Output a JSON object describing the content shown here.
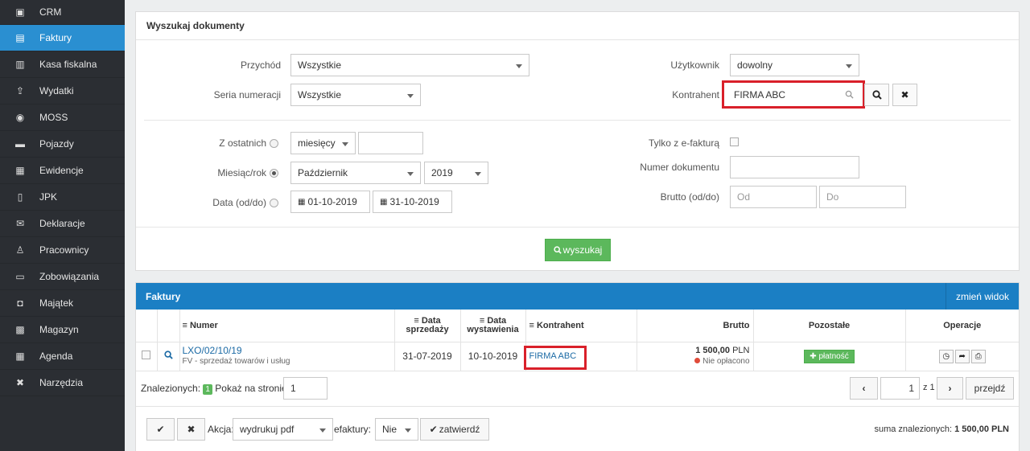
{
  "sidebar": {
    "items": [
      {
        "label": "CRM",
        "icon": "crm-icon"
      },
      {
        "label": "Faktury",
        "icon": "invoice-icon",
        "active": true
      },
      {
        "label": "Kasa fiskalna",
        "icon": "cash-register-icon"
      },
      {
        "label": "Wydatki",
        "icon": "expenses-icon"
      },
      {
        "label": "MOSS",
        "icon": "moss-icon"
      },
      {
        "label": "Pojazdy",
        "icon": "truck-icon"
      },
      {
        "label": "Ewidencje",
        "icon": "records-icon"
      },
      {
        "label": "JPK",
        "icon": "jpk-icon"
      },
      {
        "label": "Deklaracje",
        "icon": "declarations-icon"
      },
      {
        "label": "Pracownicy",
        "icon": "employees-icon"
      },
      {
        "label": "Zobowiązania",
        "icon": "liabilities-icon"
      },
      {
        "label": "Majątek",
        "icon": "camera-icon"
      },
      {
        "label": "Magazyn",
        "icon": "warehouse-icon"
      },
      {
        "label": "Agenda",
        "icon": "calendar-icon"
      },
      {
        "label": "Narzędzia",
        "icon": "tools-icon"
      }
    ]
  },
  "search": {
    "title": "Wyszukaj dokumenty",
    "przychod_label": "Przychód",
    "przychod_value": "Wszystkie",
    "seria_label": "Seria numeracji",
    "seria_value": "Wszystkie",
    "uzytkownik_label": "Użytkownik",
    "uzytkownik_value": "dowolny",
    "kontrahent_label": "Kontrahent",
    "kontrahent_value": "FIRMA ABC",
    "z_ostatnich_label": "Z ostatnich",
    "z_ostatnich_unit": "miesięcy",
    "z_ostatnich_value": "",
    "miesiac_label": "Miesiąc/rok",
    "miesiac_value": "Październik",
    "rok_value": "2019",
    "data_label": "Data (od/do)",
    "data_od": "01-10-2019",
    "data_do": "31-10-2019",
    "efaktura_label": "Tylko z e-fakturą",
    "numer_label": "Numer dokumentu",
    "numer_value": "",
    "brutto_label": "Brutto (od/do)",
    "brutto_od_placeholder": "Od",
    "brutto_do_placeholder": "Do",
    "search_button": "wyszukaj"
  },
  "invoices": {
    "title": "Faktury",
    "change_view": "zmień widok",
    "columns": {
      "numer": "Numer",
      "data_sprzedazy_1": "Data",
      "data_sprzedazy_2": "sprzedaży",
      "data_wystawienia_1": "Data",
      "data_wystawienia_2": "wystawienia",
      "kontrahent": "Kontrahent",
      "brutto": "Brutto",
      "pozostale": "Pozostałe",
      "operacje": "Operacje"
    },
    "rows": [
      {
        "numer": "LXO/02/10/19",
        "typ": "FV - sprzedaż towarów i usług",
        "data_sprzedazy": "31-07-2019",
        "data_wystawienia": "10-10-2019",
        "kontrahent": "FIRMA ABC",
        "brutto": "1 500,00",
        "waluta": "PLN",
        "status": "Nie opłacono",
        "pay_label": "płatność"
      }
    ],
    "found_label": "Znalezionych:",
    "found_count": "1",
    "per_page_label": "Pokaż na stronie:",
    "per_page_value": "1",
    "page_value": "1",
    "page_of": "z 1",
    "go_label": "przejdź"
  },
  "bottom": {
    "akcja_label": "Akcja:",
    "akcja_value": "wydrukuj pdf",
    "efaktury_label": "efaktury:",
    "efaktury_value": "Nie",
    "confirm_label": "zatwierdź",
    "sum_label": "suma znalezionych:",
    "sum_value": "1 500,00 PLN"
  }
}
